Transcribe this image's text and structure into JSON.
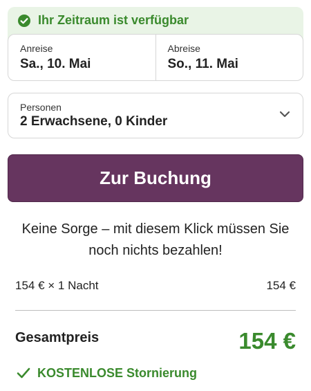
{
  "availability": {
    "text": "Ihr Zeitraum ist verfügbar",
    "icon": "check-circle-icon",
    "color": "#3a8a2d",
    "background": "#e9f4e6"
  },
  "dates": {
    "arrival_label": "Anreise",
    "arrival_value": "Sa., 10. Mai",
    "departure_label": "Abreise",
    "departure_value": "So., 11. Mai"
  },
  "persons": {
    "label": "Personen",
    "value": "2 Erwachsene, 0 Kinder",
    "icon": "chevron-down-icon"
  },
  "booking": {
    "button_label": "Zur Buchung",
    "button_color": "#66355f"
  },
  "reassurance": {
    "line1": "Keine Sorge – mit diesem Klick müssen Sie",
    "line2": "noch nichts bezahlen!"
  },
  "pricing": {
    "line_label": "154 € × 1 Nacht",
    "line_amount": "154 €",
    "total_label": "Gesamtpreis",
    "total_amount": "154 €",
    "total_color": "#3a8a2d"
  },
  "cancellation": {
    "text": "KOSTENLOSE Stornierung",
    "icon": "check-icon"
  }
}
